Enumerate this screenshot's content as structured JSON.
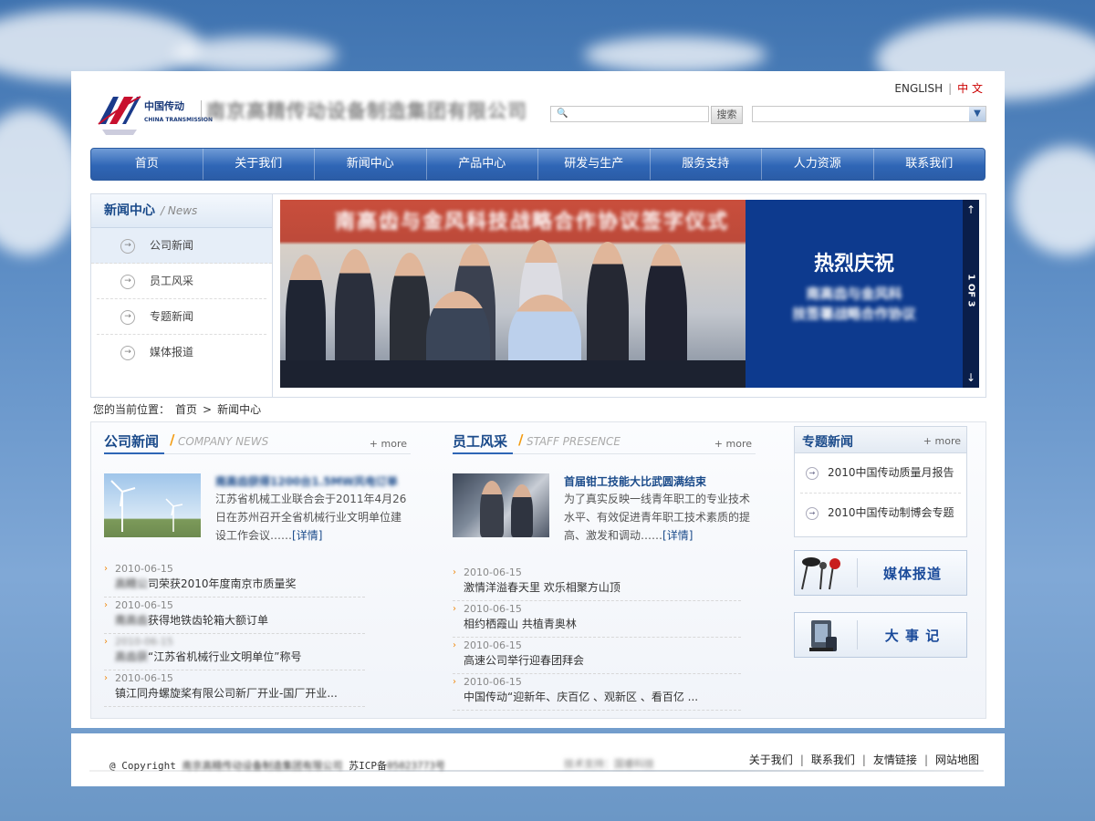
{
  "header": {
    "logo_cn": "中国传动",
    "logo_en": "CHINA TRANSMISSION",
    "company_name": "南京高精传动设备制造集团有限公司",
    "lang_en": "ENGLISH",
    "lang_sep": "|",
    "lang_zh": "中 文",
    "search_placeholder": "",
    "search_button": "搜索",
    "select_value": ""
  },
  "nav": [
    "首页",
    "关于我们",
    "新闻中心",
    "产品中心",
    "研发与生产",
    "服务支持",
    "人力资源",
    "联系我们"
  ],
  "left_menu": {
    "title_cn": "新闻中心",
    "title_en": "/ News",
    "items": [
      "公司新闻",
      "员工风采",
      "专题新闻",
      "媒体报道"
    ]
  },
  "banner": {
    "red_text": "南高齿与金风科技战略合作协议签字仪式",
    "headline": "热烈庆祝",
    "sub1": "南高齿与金风科",
    "sub2": "技签署战略合作协议",
    "pager_up": "↑",
    "pager_text": "1 OF 3",
    "pager_down": "↓"
  },
  "breadcrumb": {
    "prefix": "您的当前位置：",
    "home": "首页",
    "arrow": ">",
    "current": "新闻中心"
  },
  "company_news": {
    "title_cn": "公司新闻",
    "slash": "/",
    "title_en": "COMPANY NEWS",
    "more": "+ more",
    "feature_title": "南高齿获得1200台1.5MW风电订单",
    "feature_text": "江苏省机械工业联合会于2011年4月26日在苏州召开全省机械行业文明单位建设工作会议……",
    "feature_more": "[详情]",
    "items": [
      {
        "date": "2010-06-15",
        "title_blur": "高精公",
        "title": "司荣获2010年度南京市质量奖"
      },
      {
        "date": "2010-06-15",
        "title_blur": "南高齿",
        "title": "获得地铁齿轮箱大额订单"
      },
      {
        "date": "2010-06-15",
        "title_blur": "高齿获",
        "title": "“江苏省机械行业文明单位”称号"
      },
      {
        "date": "2010-06-15",
        "title_blur": "",
        "title": "镇江同舟螺旋桨有限公司新厂开业-国厂开业..."
      }
    ]
  },
  "staff": {
    "title_cn": "员工风采",
    "slash": "/",
    "title_en": "STAFF PRESENCE",
    "more": "+ more",
    "feature_title": "首届钳工技能大比武圆满结束",
    "feature_text": "为了真实反映一线青年职工的专业技术水平、有效促进青年职工技术素质的提高、激发和调动……",
    "feature_more": "[详情]",
    "items": [
      {
        "date": "2010-06-15",
        "title": "激情洋溢春天里 欢乐相聚方山顶"
      },
      {
        "date": "2010-06-15",
        "title": "相约栖霞山 共植青奥林"
      },
      {
        "date": "2010-06-15",
        "title": "高速公司举行迎春团拜会"
      },
      {
        "date": "2010-06-15",
        "title": "中国传动“迎新年、庆百亿 、观新区 、看百亿 ..."
      }
    ]
  },
  "special": {
    "title_cn": "专题新闻",
    "more": "+ more",
    "items": [
      "2010中国传动质量月报告",
      "2010中国传动制博会专题"
    ]
  },
  "side_buttons": {
    "media": "媒体报道",
    "events": "大 事 记"
  },
  "footer": {
    "copy_prefix": "@ Copyright",
    "copy_company": "南京高精传动设备制造集团有限公司",
    "icp_label": "苏ICP备",
    "icp_num": "05023773号",
    "tech": "技术支持：国睿科技",
    "links": [
      "关于我们",
      "联系我们",
      "友情链接",
      "网站地图"
    ],
    "sep": "|"
  }
}
